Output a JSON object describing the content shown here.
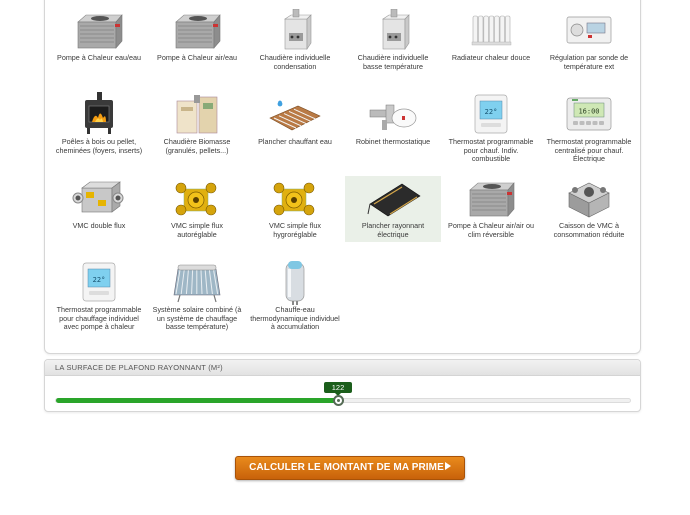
{
  "equipment": {
    "items": [
      {
        "label": "Pompe à Chaleur eau/eau",
        "icon": "heat-pump-icon",
        "selected": false
      },
      {
        "label": "Pompe à Chaleur air/eau",
        "icon": "heat-pump-icon",
        "selected": false
      },
      {
        "label": "Chaudière individuelle condensation",
        "icon": "boiler-icon",
        "selected": false
      },
      {
        "label": "Chaudière individuelle basse température",
        "icon": "boiler-icon",
        "selected": false
      },
      {
        "label": "Radiateur chaleur douce",
        "icon": "radiator-icon",
        "selected": false
      },
      {
        "label": "Régulation par sonde de température ext",
        "icon": "regulator-icon",
        "selected": false
      },
      {
        "label": "Poêles à bois ou pellet, cheminées (foyers, inserts)",
        "icon": "wood-stove-icon",
        "selected": false
      },
      {
        "label": "Chaudière Biomasse (granulés, pellets...)",
        "icon": "biomass-boiler-icon",
        "selected": false
      },
      {
        "label": "Plancher chauffant eau",
        "icon": "floor-heating-icon",
        "selected": false
      },
      {
        "label": "Robinet thermostatique",
        "icon": "thermostatic-valve-icon",
        "selected": false
      },
      {
        "label": "Thermostat programmable pour chauf. Indiv. combustible",
        "icon": "thermostat-icon",
        "selected": false
      },
      {
        "label": "Thermostat programmable centralisé pour chauf. Électrique",
        "icon": "central-thermostat-icon",
        "selected": false
      },
      {
        "label": "VMC double flux",
        "icon": "vmc-double-icon",
        "selected": false
      },
      {
        "label": "VMC simple flux autoréglable",
        "icon": "vmc-simple-icon",
        "selected": false
      },
      {
        "label": "VMC simple flux hygroréglable",
        "icon": "vmc-simple-icon",
        "selected": false
      },
      {
        "label": "Plancher rayonnant électrique",
        "icon": "electric-floor-icon",
        "selected": true
      },
      {
        "label": "Pompe à Chaleur air/air ou clim réversible",
        "icon": "heat-pump-icon",
        "selected": false
      },
      {
        "label": "Caisson de VMC à consommation réduite",
        "icon": "vmc-box-icon",
        "selected": false
      },
      {
        "label": "Thermostat programmable pour chauffage individuel avec pompe à chaleur",
        "icon": "thermostat-icon",
        "selected": false
      },
      {
        "label": "Système solaire combiné (à un système de chauffage basse température)",
        "icon": "solar-system-icon",
        "selected": false
      },
      {
        "label": "Chauffe-eau thermodynamique individuel à accumulation",
        "icon": "water-heater-icon",
        "selected": false
      }
    ]
  },
  "slider": {
    "title": "LA SURFACE DE PLAFOND RAYONNANT (M²)",
    "value": "122",
    "fraction": 0.49
  },
  "cta": {
    "label": "CALCULER LE MONTANT DE MA PRIME"
  },
  "colors": {
    "accent_green": "#2aa52a",
    "bubble_green": "#1b5e1b",
    "cta_orange": "#d9740f"
  }
}
